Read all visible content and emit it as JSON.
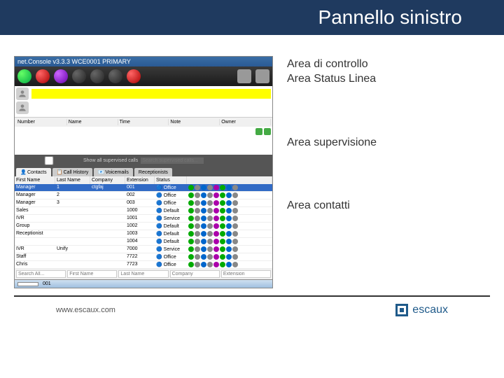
{
  "slide": {
    "title": "Pannello sinistro"
  },
  "labels": {
    "control_area": "Area di controllo",
    "status_line_area": "Area Status Linea",
    "supervision_area": "Area supervisione",
    "contacts_area": "Area contatti"
  },
  "app": {
    "title": "net.Console v3.3.3 WCE0001 PRIMARY",
    "supervision": {
      "headers": [
        "Number",
        "Name",
        "Time",
        "Note",
        "Owner"
      ]
    },
    "contacts_bar": {
      "show_all": "Show all supervised calls",
      "search_placeholder": "Search supervised calls..."
    },
    "tabs": [
      "Contacts",
      "Call History",
      "Voicemails",
      "Receptionists"
    ],
    "table": {
      "headers": [
        "First Name",
        "Last Name",
        "Company",
        "Extension",
        "Status"
      ],
      "rows": [
        {
          "first": "Manager",
          "last": "1",
          "company": "ctgfaj",
          "ext": "001",
          "status": "Office"
        },
        {
          "first": "Manager",
          "last": "2",
          "company": "",
          "ext": "002",
          "status": "Office"
        },
        {
          "first": "Manager",
          "last": "3",
          "company": "",
          "ext": "003",
          "status": "Office"
        },
        {
          "first": "Sales",
          "last": "",
          "company": "",
          "ext": "1000",
          "status": "Default"
        },
        {
          "first": "IVR",
          "last": "",
          "company": "",
          "ext": "1001",
          "status": "Service"
        },
        {
          "first": "Group",
          "last": "",
          "company": "",
          "ext": "1002",
          "status": "Default"
        },
        {
          "first": "Receptionist",
          "last": "",
          "company": "",
          "ext": "1003",
          "status": "Default"
        },
        {
          "first": "",
          "last": "",
          "company": "",
          "ext": "1004",
          "status": "Default"
        },
        {
          "first": "IVR",
          "last": "Unify",
          "company": "",
          "ext": "7000",
          "status": "Service"
        },
        {
          "first": "Staff",
          "last": "",
          "company": "",
          "ext": "7722",
          "status": "Office"
        },
        {
          "first": "Chris",
          "last": "",
          "company": "",
          "ext": "7723",
          "status": "Office"
        }
      ]
    },
    "search": {
      "all": "Search All...",
      "first": "First Name",
      "last": "Last Name",
      "company": "Company",
      "ext": "Extension"
    },
    "bottom": {
      "ext": "001"
    }
  },
  "footer": {
    "url": "www.escaux.com",
    "brand": "escaux"
  }
}
